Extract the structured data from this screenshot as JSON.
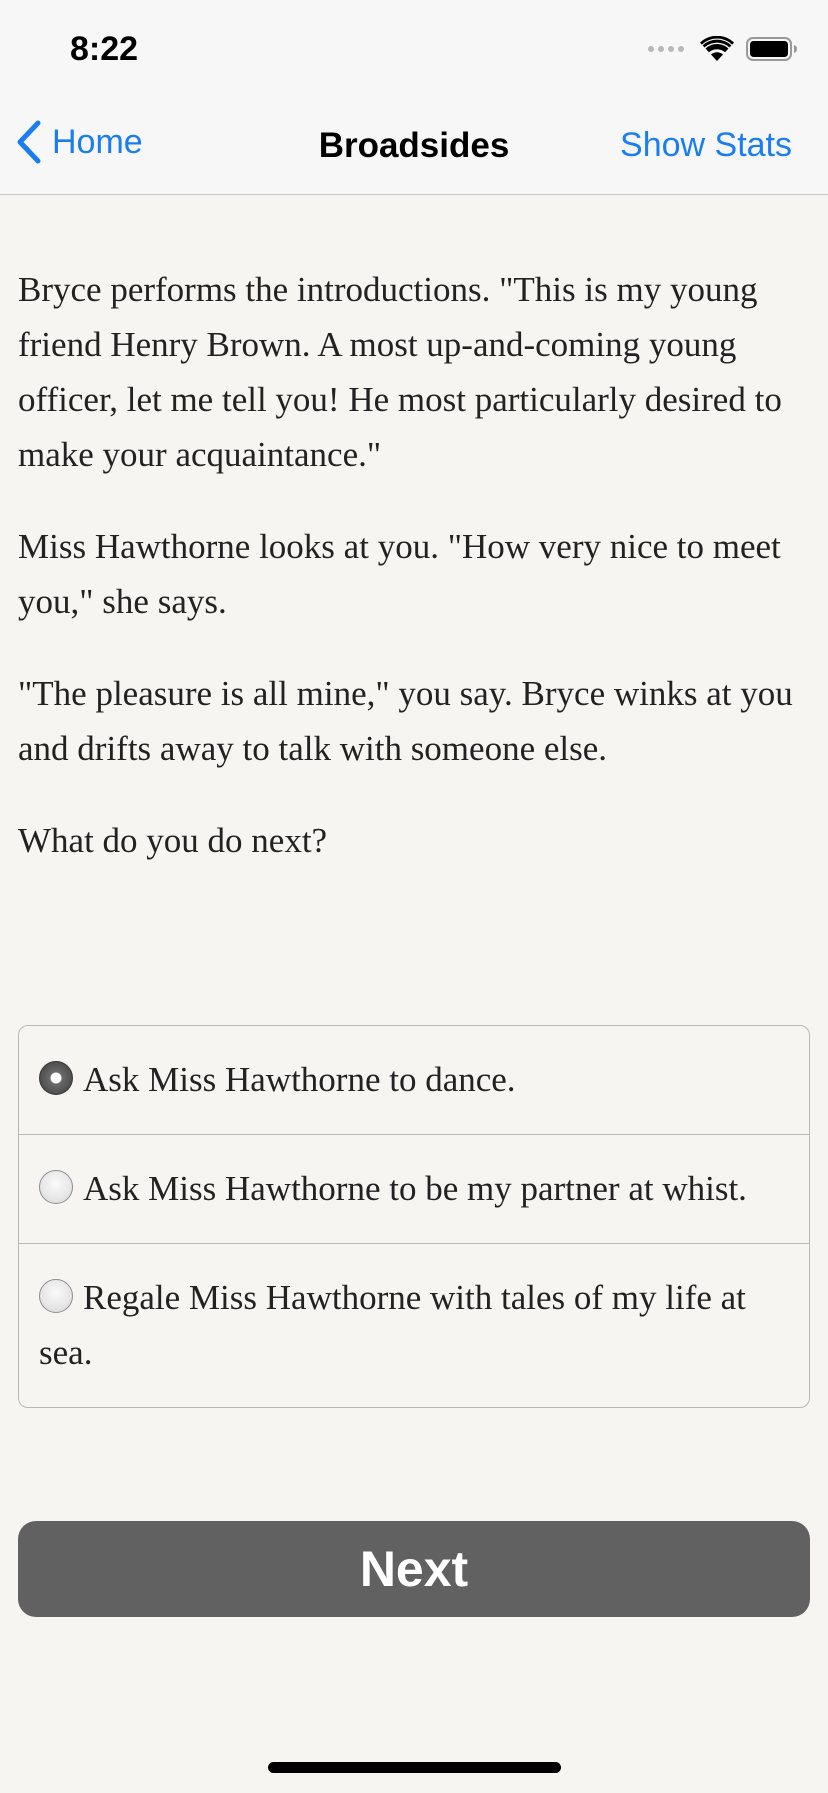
{
  "status_bar": {
    "time": "8:22"
  },
  "nav": {
    "back_label": "Home",
    "title": "Broadsides",
    "right_label": "Show Stats"
  },
  "story": {
    "paragraphs": [
      "Bryce performs the introductions. \"This is my young friend Henry Brown. A most up-and-coming young officer, let me tell you! He most particularly desired to make your acquaintance.\"",
      "Miss Hawthorne looks at you. \"How very nice to meet you,\" she says.",
      "\"The pleasure is all mine,\" you say. Bryce winks at you and drifts away to talk with someone else.",
      "What do you do next?"
    ]
  },
  "choices": [
    {
      "label": "Ask Miss Hawthorne to dance.",
      "selected": true
    },
    {
      "label": "Ask Miss Hawthorne to be my partner at whist.",
      "selected": false
    },
    {
      "label": "Regale Miss Hawthorne with tales of my life at sea.",
      "selected": false
    }
  ],
  "next_label": "Next",
  "colors": {
    "accent": "#1a7ef0",
    "background": "#f7f5f2",
    "button": "#616161"
  }
}
